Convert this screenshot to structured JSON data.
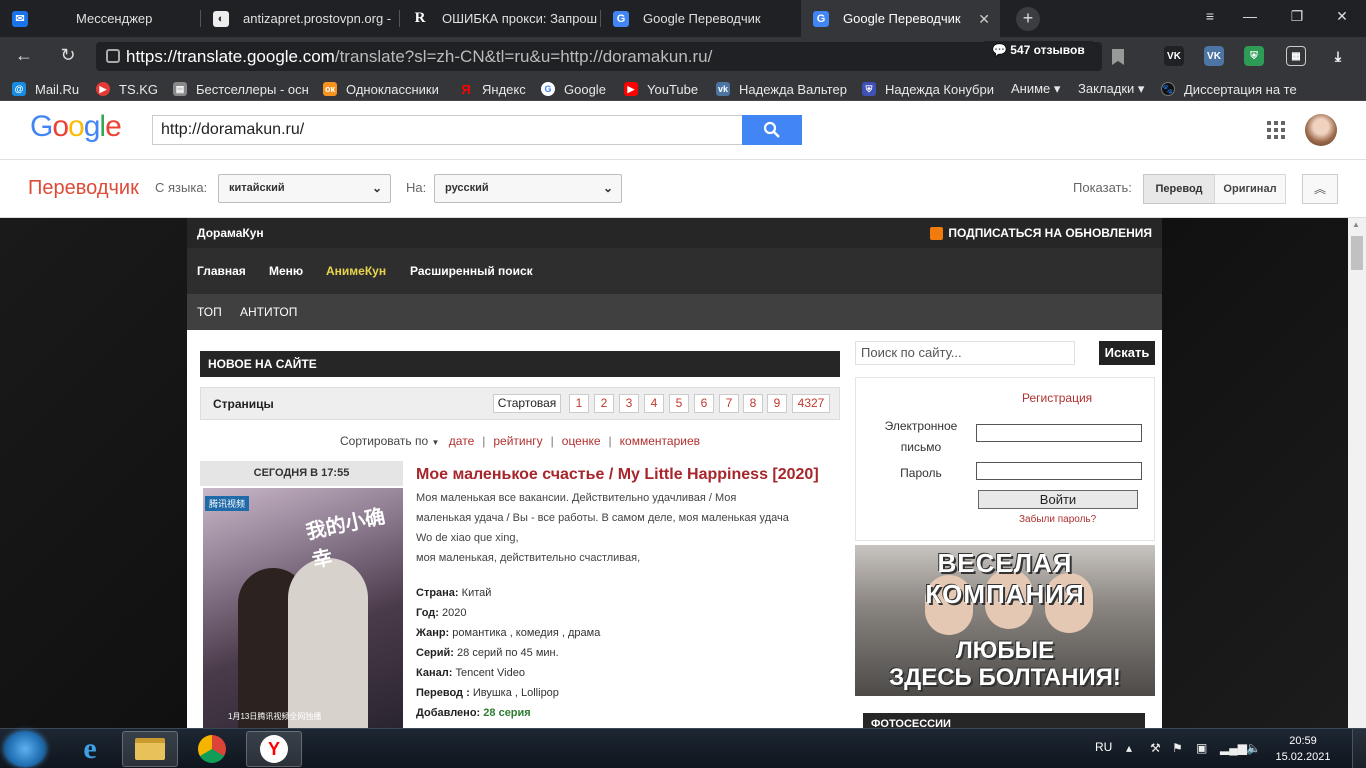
{
  "browser": {
    "tabs": [
      {
        "label": "Мессенджер",
        "icon": "messenger-icon"
      },
      {
        "label": "antizapret.prostovpn.org -",
        "icon": "page-icon"
      },
      {
        "label": "ОШИБКА прокси: Запрош",
        "icon": "r-icon"
      },
      {
        "label": "Google Переводчик",
        "icon": "google-translate-icon"
      },
      {
        "label": "Google Переводчик",
        "icon": "google-translate-icon",
        "active": true
      }
    ],
    "url_host": "https://translate.google.com",
    "url_path": "/translate?sl=zh-CN&tl=ru&u=http://doramakun.ru/",
    "reviews_badge": "547 отзывов",
    "bookmarks": [
      {
        "label": "Mail.Ru",
        "icon": "mailru-icon",
        "color": "#168de2"
      },
      {
        "label": "TS.KG",
        "icon": "tskg-icon",
        "color": "#e53935"
      },
      {
        "label": "Бестселлеры - осн",
        "icon": "book-icon",
        "color": "#888888"
      },
      {
        "label": "Одноклассники",
        "icon": "odnoklassniki-icon",
        "color": "#f7931e"
      },
      {
        "label": "Яндекс",
        "icon": "yandex-icon",
        "color": "#ff0000"
      },
      {
        "label": "Google",
        "icon": "google-icon",
        "color": "#4285f4"
      },
      {
        "label": "YouTube",
        "icon": "youtube-icon",
        "color": "#ff0000"
      },
      {
        "label": "Надежда Вальтер",
        "icon": "vk-icon",
        "color": "#4c75a3"
      },
      {
        "label": "Надежда Конубри",
        "icon": "shield-icon",
        "color": "#3f51b5"
      },
      {
        "label": "Аниме ▾",
        "icon": "",
        "color": ""
      },
      {
        "label": "Закладки ▾",
        "icon": "",
        "color": ""
      },
      {
        "label": "Диссертация на те",
        "icon": "paw-icon",
        "color": "#111111"
      }
    ]
  },
  "google": {
    "logo": "Google",
    "search_value": "http://doramakun.ru/"
  },
  "translate": {
    "title": "Переводчик",
    "from_label": "С языка:",
    "from_value": "китайский",
    "to_label": "На:",
    "to_value": "русский",
    "show_label": "Показать:",
    "btn_translation": "Перевод",
    "btn_original": "Оригинал"
  },
  "site": {
    "brand": "ДорамаКун",
    "subscribe": "ПОДПИСАТЬСЯ НА ОБНОВЛЕНИЯ",
    "nav": [
      "Главная",
      "Меню",
      "АнимеКун",
      "Расширенный поиск"
    ],
    "subnav": [
      "ТОП",
      "АНТИТОП"
    ],
    "new_header": "НОВОЕ НА САЙТЕ",
    "pages_label": "Страницы",
    "pages": [
      "Стартовая",
      "1",
      "2",
      "3",
      "4",
      "5",
      "6",
      "7",
      "8",
      "9",
      "4327"
    ],
    "sort_label": "Сортировать по",
    "sort_options": [
      "дате",
      "рейтингу",
      "оценке",
      "комментариев"
    ],
    "post": {
      "date": "СЕГОДНЯ В 17:55",
      "title": "Мое маленькое счастье / My Little Happiness [2020]",
      "desc_lines": [
        "Моя маленькая все вакансии. Действительно удачливая / Моя",
        "маленькая удача / Вы - все работы. В самом деле, моя маленькая удача",
        "Wo de xiao que xing,",
        "моя маленькая, действительно счастливая,"
      ],
      "poster_cn": "我的小确幸",
      "poster_tag": "腾讯视频",
      "poster_bottom": "1月13日腾讯视频全网独播",
      "meta": [
        {
          "label": "Страна:",
          "value": "Китай"
        },
        {
          "label": "Год:",
          "value": "2020"
        },
        {
          "label": "Жанр:",
          "value": "романтика , комедия , драма"
        },
        {
          "label": "Серий:",
          "value": "28 серий по 45 мин."
        },
        {
          "label": "Канал:",
          "value": "Tencent Video"
        },
        {
          "label": "Перевод :",
          "value": "Ивушка , Lollipop"
        },
        {
          "label": "Добавлено:",
          "value": "28 серия"
        }
      ]
    },
    "sidebar": {
      "search_placeholder": "Поиск по сайту...",
      "search_btn": "Искать",
      "register": "Регистрация",
      "email_label": "Электронное письмо",
      "password_label": "Пароль",
      "login_btn": "Войти",
      "forgot": "Забыли пароль?",
      "banner_top": "ВЕСЕЛАЯ КОМПАНИЯ",
      "banner_bottom_1": "ЛЮБЫЕ",
      "banner_bottom_2": "ЗДЕСЬ БОЛТАНИЯ!",
      "photo_header": "ФОТОСЕССИИ"
    }
  },
  "taskbar": {
    "lang": "RU",
    "time": "20:59",
    "date": "15.02.2021"
  },
  "colors": {
    "translate_red": "#dd4b39",
    "site_link_red": "#a6262c",
    "google_blue": "#4285f4",
    "added_green": "#2e7d32"
  }
}
